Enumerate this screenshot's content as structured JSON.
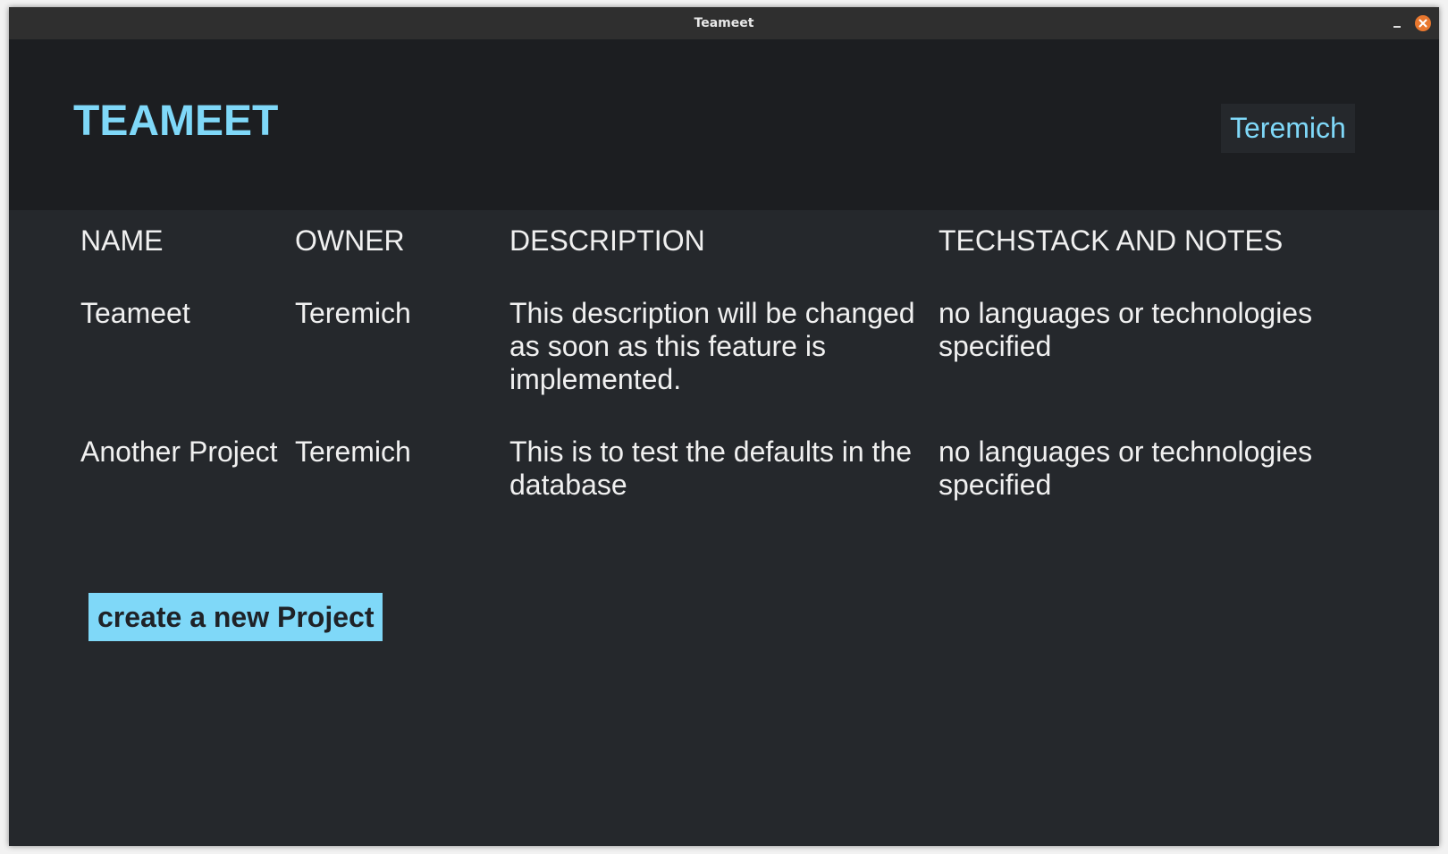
{
  "window": {
    "title": "Teameet"
  },
  "header": {
    "brand": "TEAMEET",
    "user_label": "Teremich"
  },
  "table": {
    "columns": [
      "NAME",
      "OWNER",
      "DESCRIPTION",
      "TECHSTACK AND NOTES"
    ],
    "rows": [
      {
        "name": "Teameet",
        "owner": "Teremich",
        "description": "This description will be changed as soon as this feature is implemented.",
        "techstack": "no languages or technologies specified"
      },
      {
        "name": "Another Project",
        "owner": "Teremich",
        "description": "This is to test the defaults in the database",
        "techstack": "no languages or technologies specified"
      }
    ]
  },
  "actions": {
    "create_label": "create a new Project"
  },
  "icons": {
    "minimize": "minimize-icon",
    "close": "close-icon"
  },
  "colors": {
    "accent": "#7fd8f8",
    "header_bg": "#1c1e21",
    "content_bg": "#25282c",
    "close_button": "#e8772e"
  }
}
